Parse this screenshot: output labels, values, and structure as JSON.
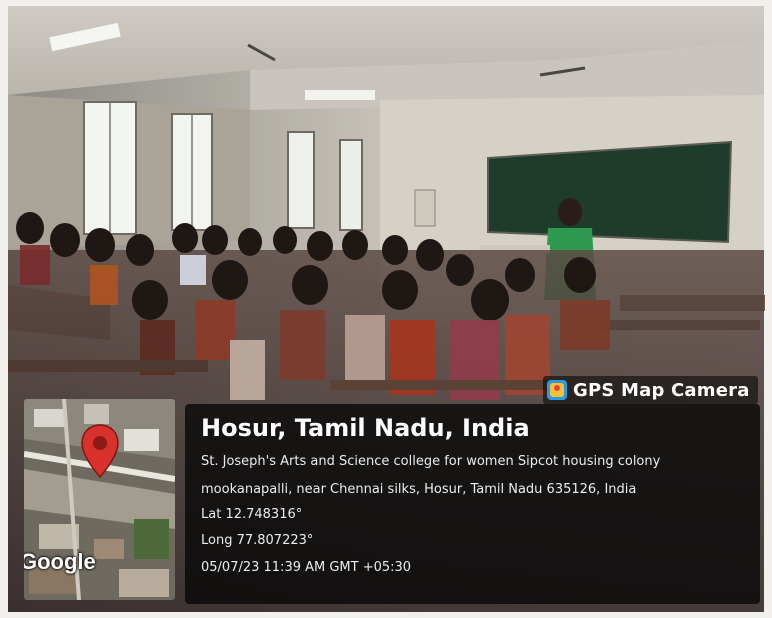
{
  "watermark": {
    "brand_label": "GPS Map Camera",
    "brand_icon": "gps-map-camera-app-icon"
  },
  "location": {
    "title": "Hosur, Tamil Nadu, India",
    "address_line1": "St. Joseph's Arts and Science college for women Sipcot housing colony",
    "address_line2": "mookanapalli, near Chennai silks, Hosur, Tamil Nadu 635126, India",
    "latitude": "Lat 12.748316°",
    "longitude": "Long 77.807223°",
    "datetime": "05/07/23 11:39 AM GMT +05:30"
  },
  "map": {
    "logo_text": "Google",
    "pin_icon": "map-pin-icon",
    "pin_color": "#d9312b"
  },
  "scene": {
    "wall_color": "#d9d4c9",
    "blackboard_color": "#1f3b2b"
  }
}
